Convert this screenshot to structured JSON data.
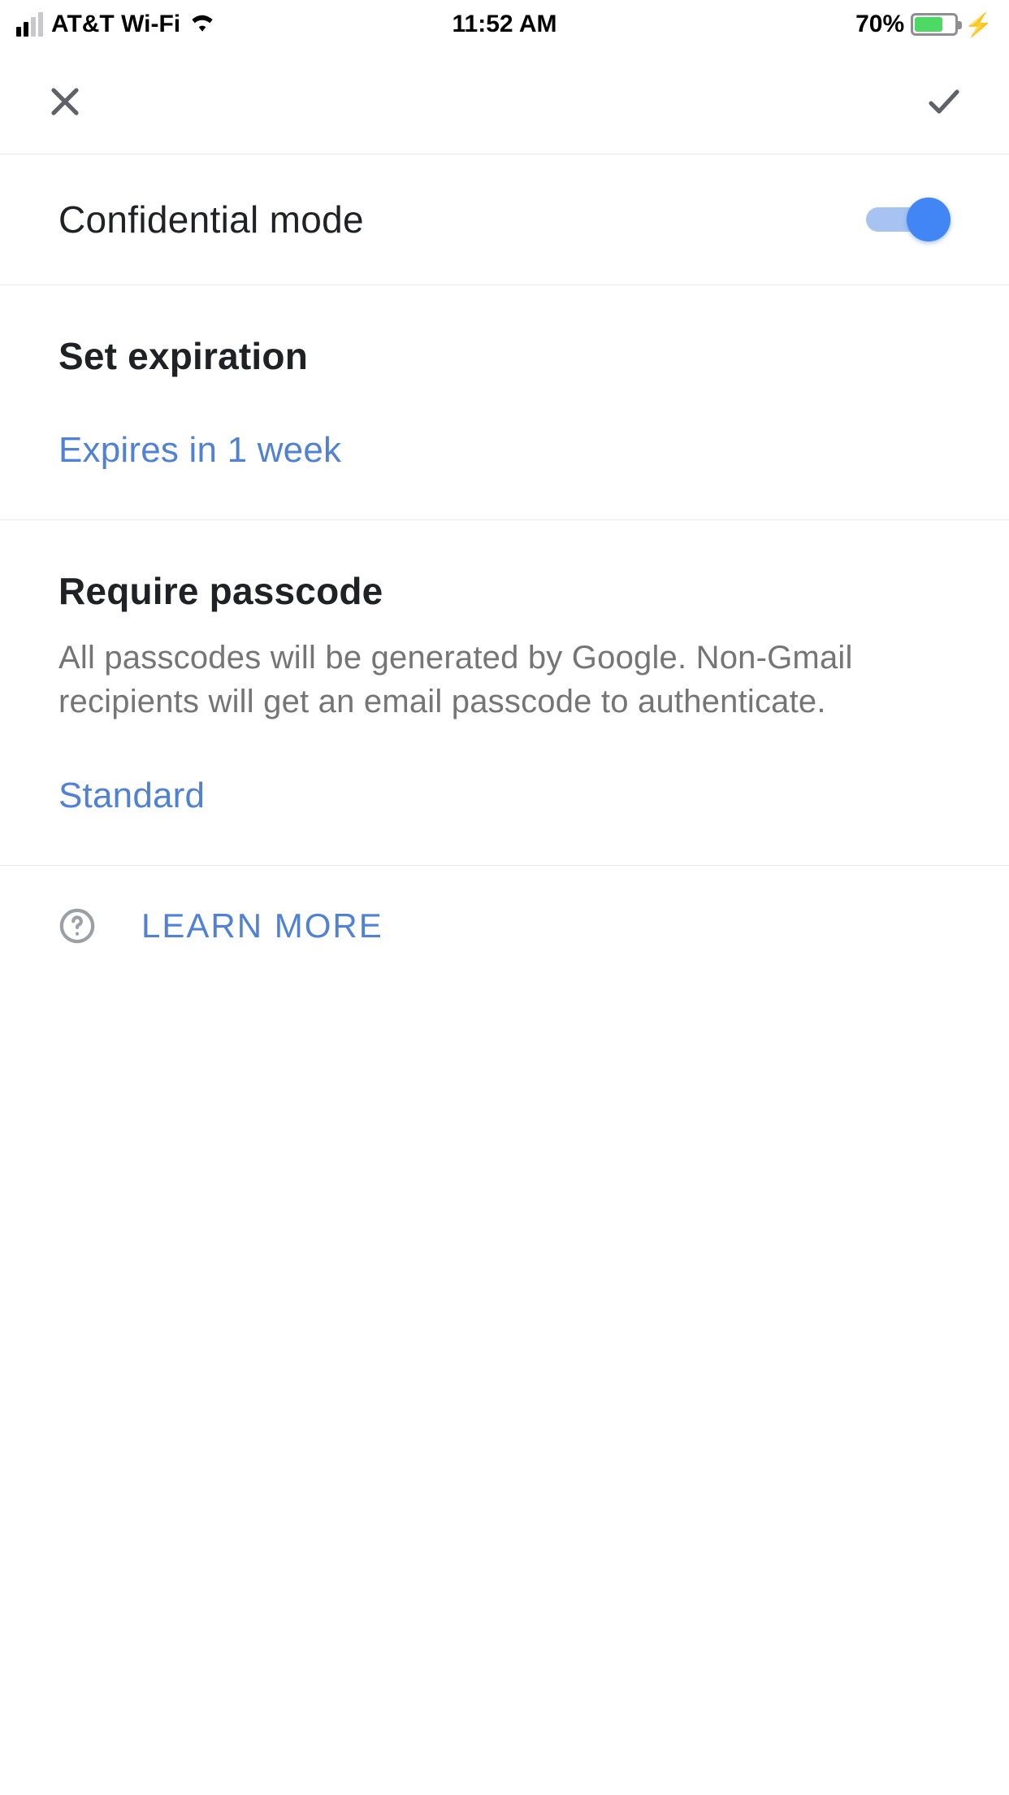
{
  "status_bar": {
    "carrier": "AT&T Wi-Fi",
    "time": "11:52 AM",
    "battery_pct": "70%"
  },
  "header": {
    "title": "Confidential mode",
    "toggle_on": true
  },
  "expiration": {
    "heading": "Set expiration",
    "value": "Expires in 1 week"
  },
  "passcode": {
    "heading": "Require passcode",
    "description": "All passcodes will be generated by Google. Non-Gmail recipients will get an email passcode to authenticate.",
    "value": "Standard"
  },
  "footer": {
    "learn_more": "LEARN MORE"
  }
}
